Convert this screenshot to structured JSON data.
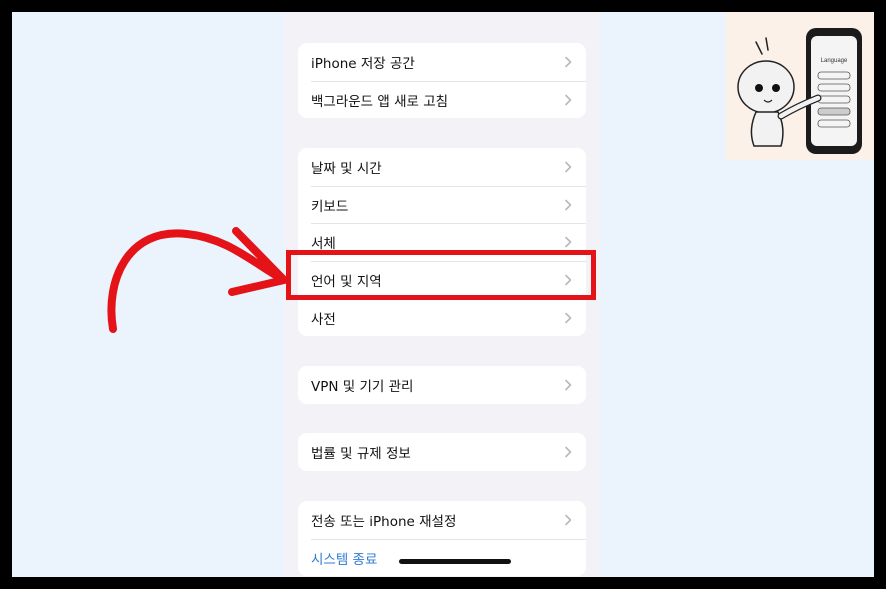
{
  "settings": {
    "group1": [
      "iPhone 저장 공간",
      "백그라운드 앱 새로 고침"
    ],
    "group2": [
      "날짜 및 시간",
      "키보드",
      "서체",
      "언어 및 지역",
      "사전"
    ],
    "group3": [
      "VPN 및 기기 관리"
    ],
    "group4": [
      "법률 및 규제 정보"
    ],
    "group5": [
      "전송 또는 iPhone 재설정",
      "시스템 종료"
    ]
  },
  "illustration": {
    "phone_screen_title": "Language"
  },
  "colors": {
    "annotation_red": "#e31318",
    "link_blue": "#2f7bd6",
    "page_bg": "#ebf3fd",
    "settings_bg": "#f2f2f7"
  }
}
